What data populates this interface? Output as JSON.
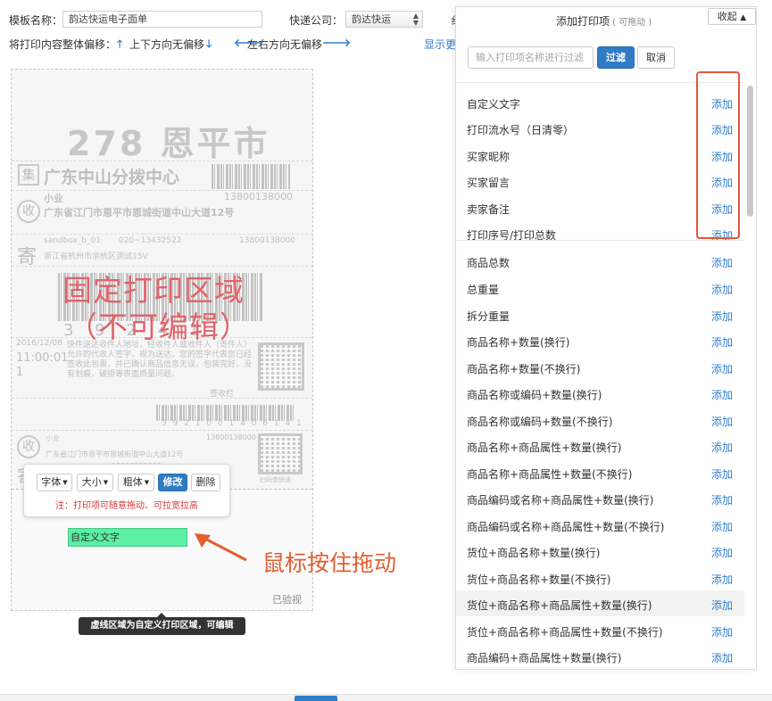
{
  "form": {
    "template_label": "模板名称：",
    "template_value": "韵达快运电子面单",
    "express_label": "快递公司：",
    "express_value": "韵达快运",
    "offset_label": "将打印内容整体偏移：",
    "vertical_offset": "上下方向无偏移",
    "horizontal_offset": "左右方向无偏移",
    "show_more": "显示更",
    "cut_char": "纟"
  },
  "label": {
    "city": "278 恩平市",
    "hub_icon": "集",
    "hub": "广东中山分拨中心",
    "recv_icon": "收",
    "recv_name": "小业",
    "recv_phone": "13800138000",
    "recv_addr": "广东省江门市恩平市恩城街道中山大道12号",
    "send_icon": "寄",
    "send_name": "sandbox_b_01",
    "send_tel": "020~13432522",
    "send_phone": "13800138000",
    "send_addr": "浙江省杭州市余杭区测试15V",
    "barcode_digits": "3 9 2   4 1",
    "date": "2016/12/08",
    "time": "11:00:01",
    "seq": "1",
    "terms": "快件送达收件人地址，经收件人或收件人（寄件人）允许的代收人签字，视为送达。您的签字代表您已经签收此包裹，并已确认商品信息无误，包装完好，没有划痕，破损等表面质量问题。",
    "sign": "签收栏",
    "barcode2_digits": "3 9 2 1 0 0 1 4 0 6 1 4 1",
    "recv2_name": "小业",
    "recv2_addr": "广东省江门市恩平市恩城街道中山大道12号",
    "recv2_phone": "13800138000",
    "send2_phone": "13800138000",
    "scan_text": "扫码查快递",
    "verified": "已验视"
  },
  "overlay": {
    "fixed_line1": "固定打印区域",
    "fixed_line2": "（不可编辑）",
    "drag_hint": "鼠标按住拖动",
    "tooltip": "虚线区域为自定义打印区域，可编辑"
  },
  "toolbar": {
    "font": "字体",
    "size": "大小",
    "bold": "粗体",
    "edit": "修改",
    "delete": "删除",
    "note": "注：打印项可随意拖动、可拉宽拉高"
  },
  "custom_item": "自定义文字",
  "panel": {
    "title": "添加打印项",
    "subtitle": "( 可拖动 )",
    "collapse": "收起",
    "filter_placeholder": "输入打印项名称进行过滤",
    "filter_btn": "过滤",
    "cancel_btn": "取消",
    "add_label": "添加",
    "items": [
      "自定义文字",
      "打印流水号（日清零）",
      "买家昵称",
      "买家留言",
      "卖家备注",
      "打印序号/打印总数",
      "商品总数",
      "总重量",
      "拆分重量",
      "商品名称+数量(换行)",
      "商品名称+数量(不换行)",
      "商品名称或编码+数量(换行)",
      "商品名称或编码+数量(不换行)",
      "商品名称+商品属性+数量(换行)",
      "商品名称+商品属性+数量(不换行)",
      "商品编码或名称+商品属性+数量(换行)",
      "商品编码或名称+商品属性+数量(不换行)",
      "货位+商品名称+数量(换行)",
      "货位+商品名称+数量(不换行)",
      "货位+商品名称+商品属性+数量(换行)",
      "货位+商品名称+商品属性+数量(不换行)",
      "商品编码+商品属性+数量(换行)"
    ]
  },
  "colors": {
    "accent": "#2f7bc4",
    "overlay_red": "#e2636a",
    "drag_orange": "#e35e2f",
    "custom_green": "#5bf0a2"
  }
}
